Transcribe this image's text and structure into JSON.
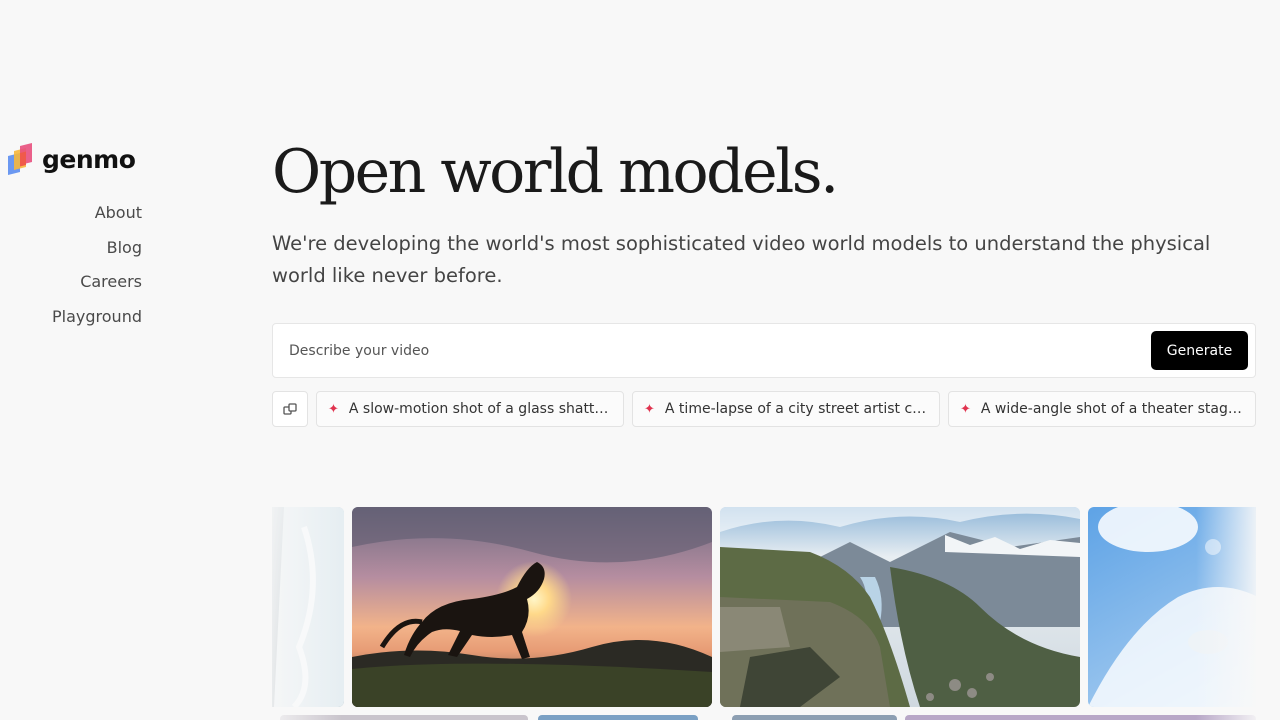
{
  "brand": {
    "name": "genmo",
    "colors": [
      "#f05a4a",
      "#f6b73c",
      "#5b8def",
      "#e84f7d"
    ]
  },
  "nav": {
    "items": [
      {
        "label": "About"
      },
      {
        "label": "Blog"
      },
      {
        "label": "Careers"
      },
      {
        "label": "Playground"
      }
    ]
  },
  "hero": {
    "title": "Open world models.",
    "subtitle": "We're developing the world's most sophisticated video world models to understand the physical world like never before."
  },
  "prompt": {
    "placeholder": "Describe your video",
    "value": "",
    "generate_label": "Generate"
  },
  "suggestions": {
    "shuffle_icon": "shuffle-icon",
    "items": [
      {
        "text": "A slow-motion shot of a glass shatt…"
      },
      {
        "text": "A time-lapse of a city street artist c…"
      },
      {
        "text": "A wide-angle shot of a theater stag…"
      }
    ]
  },
  "gallery": {
    "accent": "#000000"
  }
}
